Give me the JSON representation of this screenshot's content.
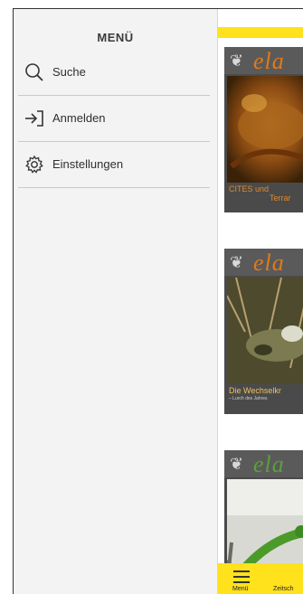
{
  "drawer": {
    "title": "MENÜ",
    "items": [
      {
        "label": "Suche",
        "icon": "search-icon"
      },
      {
        "label": "Anmelden",
        "icon": "login-icon"
      },
      {
        "label": "Einstellungen",
        "icon": "gear-icon"
      }
    ]
  },
  "covers": [
    {
      "logo": "ela",
      "caption": "CITES und",
      "caption_line2": "Terrar",
      "caption_color": "#e08a2a",
      "logo_color": "#e07a1a"
    },
    {
      "logo": "ela",
      "caption": "Die Wechselkr",
      "caption_line2": "– Lurch des Jahres",
      "caption_color": "#f0c060",
      "logo_color": "#e07a1a"
    },
    {
      "logo": "ela",
      "caption": "",
      "caption_line2": "",
      "caption_color": "#ffffff",
      "logo_color": "#5aa03a"
    }
  ],
  "bottom_nav": {
    "menu_label": "Menü",
    "second_label": "Zeitsch"
  },
  "colors": {
    "accent_yellow": "#ffe11c",
    "drawer_bg": "#f3f3f3"
  }
}
